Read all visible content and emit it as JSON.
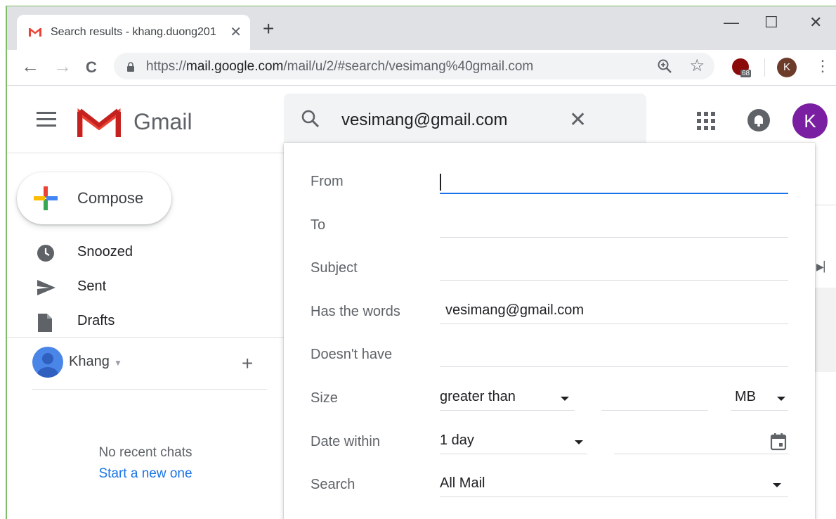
{
  "browser": {
    "tab_title": "Search results - khang.duong201",
    "new_tab": "+",
    "close_tab": "✕",
    "minimize": "—",
    "maximize": "☐",
    "close_window": "✕",
    "back": "←",
    "forward": "→",
    "reload": "C",
    "url_prefix": "https://",
    "url_host": "mail.google.com",
    "url_path": "/mail/u/2/#search/vesimang%40gmail.com",
    "star": "☆",
    "extension_badge": "68",
    "profile_initial": "K",
    "menu": "⋮"
  },
  "header": {
    "app_name": "Gmail",
    "search_value": "vesimang@gmail.com",
    "search_clear": "✕",
    "account_initial": "K"
  },
  "sidebar": {
    "compose_label": "Compose",
    "items": [
      {
        "label": "Snoozed",
        "icon": "clock-icon"
      },
      {
        "label": "Sent",
        "icon": "send-icon"
      },
      {
        "label": "Drafts",
        "icon": "draft-icon"
      }
    ],
    "hangouts_user": "Khang",
    "hangouts_add": "+",
    "no_chats": "No recent chats",
    "start_new": "Start a new one"
  },
  "advanced_search": {
    "from": {
      "label": "From",
      "value": ""
    },
    "to": {
      "label": "To",
      "value": ""
    },
    "subject": {
      "label": "Subject",
      "value": ""
    },
    "has_words": {
      "label": "Has the words",
      "value": "vesimang@gmail.com"
    },
    "doesnt_have": {
      "label": "Doesn't have",
      "value": ""
    },
    "size": {
      "label": "Size",
      "comparator": "greater than",
      "value": "",
      "unit": "MB"
    },
    "date_within": {
      "label": "Date within",
      "value": "1 day",
      "date": ""
    },
    "search_in": {
      "label": "Search",
      "value": "All Mail"
    }
  },
  "colors": {
    "accent_blue": "#1a73e8",
    "account_purple": "#7b1fa2",
    "gmail_red": "#ea4335"
  }
}
